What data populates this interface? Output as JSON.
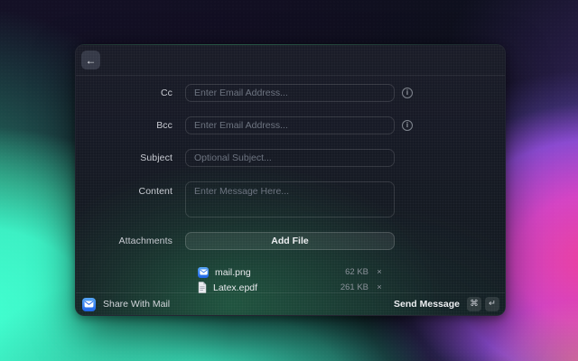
{
  "colors": {
    "mail_app_blue": "#2f6fe4",
    "wallpaper_turquoise": "#3ffbc8",
    "wallpaper_magenta": "#ee3f9b",
    "wallpaper_purple": "#8a4ad0",
    "window_green_glow": "#287a52"
  },
  "icons": {
    "back_arrow": "←",
    "info": "i",
    "close": "×",
    "command": "⌘",
    "return": "↵"
  },
  "window": {
    "form": {
      "rows": [
        {
          "label": "Cc",
          "placeholder": "Enter Email Address...",
          "has_info": true
        },
        {
          "label": "Bcc",
          "placeholder": "Enter Email Address...",
          "has_info": true
        },
        {
          "label": "Subject",
          "placeholder": "Optional Subject...",
          "has_info": false
        },
        {
          "label": "Content",
          "placeholder": "Enter Message Here...",
          "has_info": false
        }
      ],
      "attachments": {
        "label": "Attachments",
        "add_file_label": "Add File",
        "files": [
          {
            "name": "mail.png",
            "size": "62 KB",
            "icon": "mail-app-icon"
          },
          {
            "name": "Latex.epdf",
            "size": "261 KB",
            "icon": "document-icon"
          }
        ]
      }
    },
    "footer": {
      "title": "Share With Mail",
      "action_label": "Send Message",
      "shortcut_keys": [
        "⌘",
        "↵"
      ]
    }
  }
}
